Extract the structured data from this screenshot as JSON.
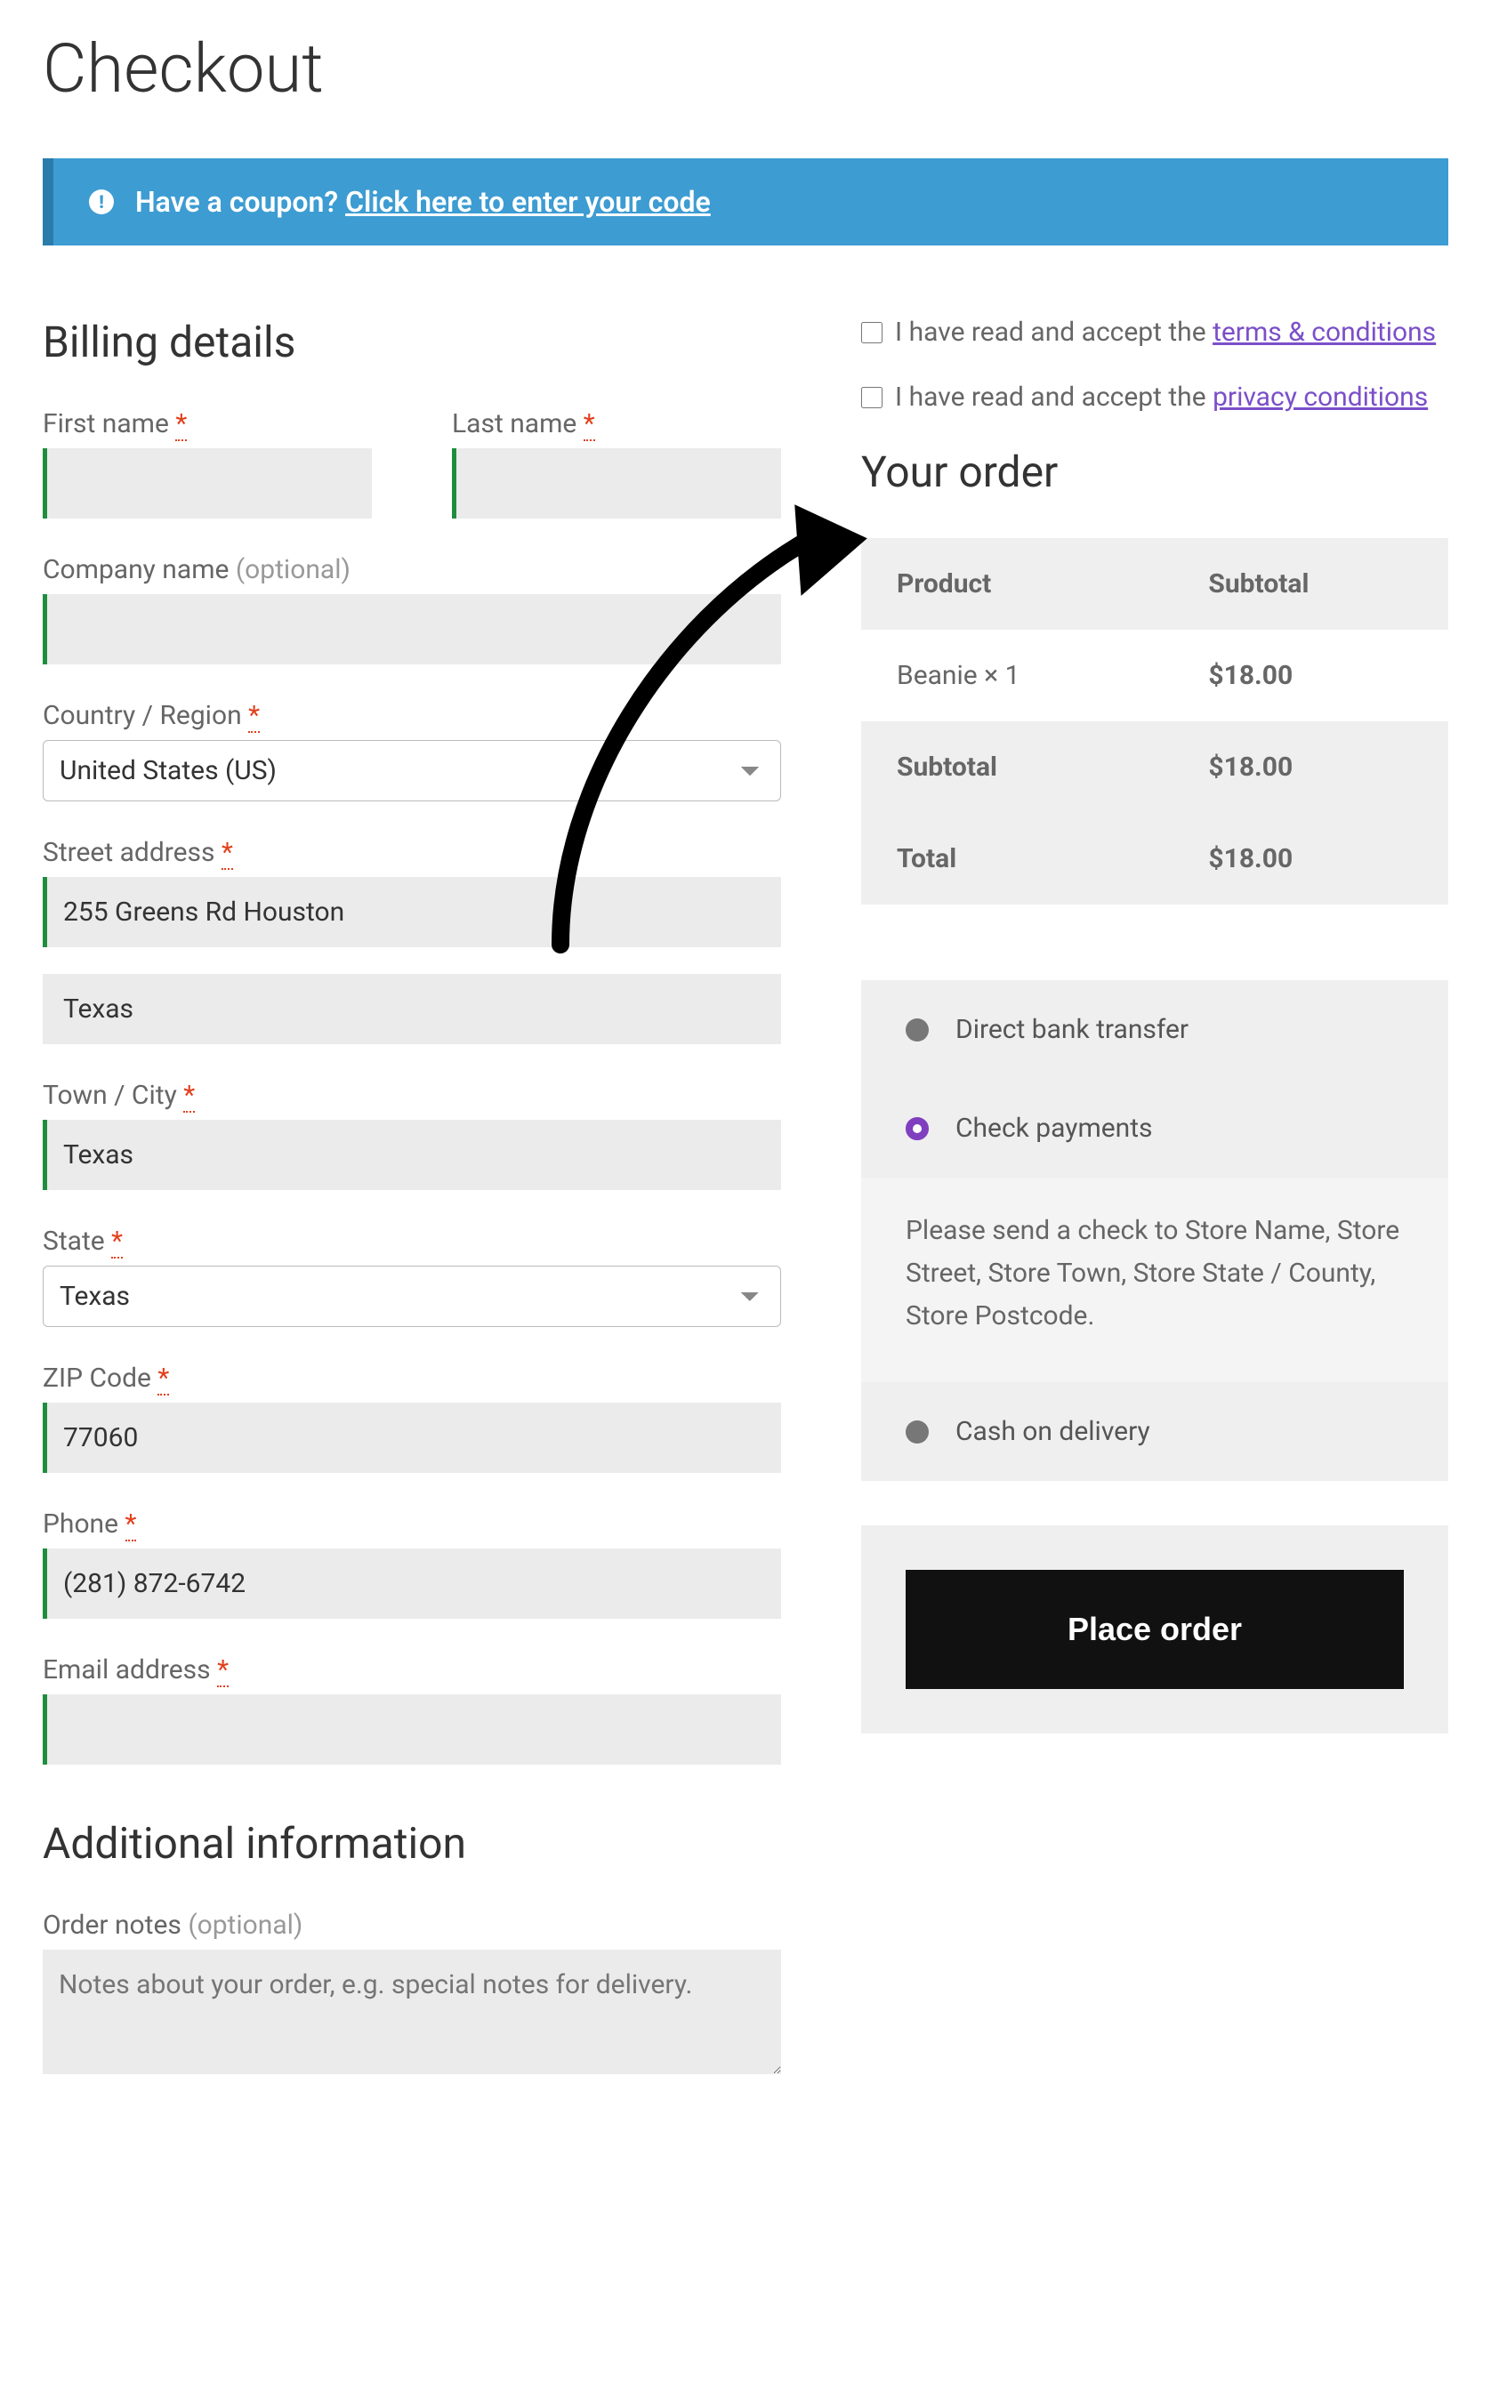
{
  "page_title": "Checkout",
  "coupon_banner": {
    "question": "Have a coupon?",
    "link_text": "Click here to enter your code"
  },
  "billing": {
    "heading": "Billing details",
    "first_name": {
      "label": "First name",
      "value": ""
    },
    "last_name": {
      "label": "Last name",
      "value": ""
    },
    "company": {
      "label_main": "Company name",
      "label_opt": "(optional)",
      "value": ""
    },
    "country": {
      "label": "Country / Region",
      "value": "United States (US)"
    },
    "street": {
      "label": "Street address",
      "value1": "255 Greens Rd Houston",
      "value2": "Texas"
    },
    "city": {
      "label": "Town / City",
      "value": "Texas"
    },
    "state": {
      "label": "State",
      "value": "Texas"
    },
    "zip": {
      "label": "ZIP Code",
      "value": "77060"
    },
    "phone": {
      "label": "Phone",
      "value": "(281) 872-6742"
    },
    "email": {
      "label": "Email address",
      "value": ""
    }
  },
  "additional": {
    "heading": "Additional information",
    "notes": {
      "label_main": "Order notes",
      "label_opt": "(optional)",
      "placeholder": "Notes about your order, e.g. special notes for delivery."
    }
  },
  "consent": {
    "terms_prefix": "I have read and accept the ",
    "terms_link": "terms & conditions",
    "privacy_prefix": "I have read and accept the ",
    "privacy_link": "privacy conditions"
  },
  "order": {
    "heading": "Your order",
    "header_product": "Product",
    "header_subtotal": "Subtotal",
    "line_item_name": "Beanie  × 1",
    "line_item_price": "$18.00",
    "subtotal_label": "Subtotal",
    "subtotal_value": "$18.00",
    "total_label": "Total",
    "total_value": "$18.00"
  },
  "payment": {
    "bank": "Direct bank transfer",
    "check": "Check payments",
    "check_desc": "Please send a check to Store Name, Store Street, Store Town, Store State / County, Store Postcode.",
    "cod": "Cash on delivery"
  },
  "place_order_label": "Place order"
}
